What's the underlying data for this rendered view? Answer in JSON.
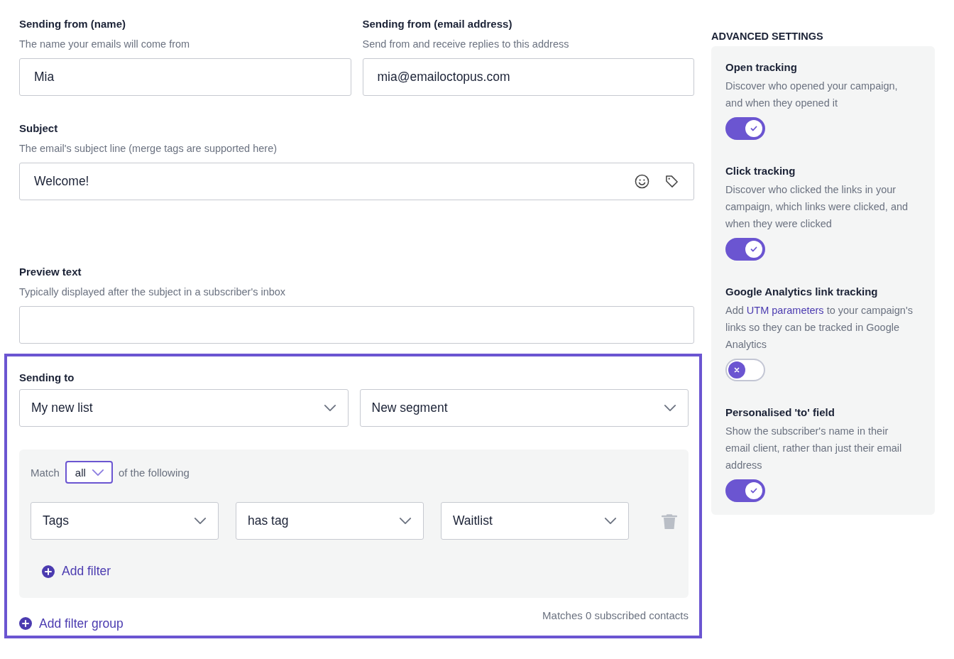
{
  "sender_name": {
    "label": "Sending from (name)",
    "help": "The name your emails will come from",
    "value": "Mia"
  },
  "sender_email": {
    "label": "Sending from (email address)",
    "help": "Send from and receive replies to this address",
    "value": "mia@emailoctopus.com"
  },
  "subject": {
    "label": "Subject",
    "help": "The email's subject line (merge tags are supported here)",
    "value": "Welcome!"
  },
  "preview_text": {
    "label": "Preview text",
    "help": "Typically displayed after the subject in a subscriber's inbox"
  },
  "sending_to": {
    "label": "Sending to",
    "highlighted": true,
    "list": "My new list",
    "segment": "New segment",
    "filter_group": {
      "match_label": "Match",
      "match_value": "all",
      "match_suffix": "of the following",
      "filters": [
        {
          "field": "Tags",
          "operator": "has tag",
          "value": "Waitlist"
        }
      ],
      "add_filter": "Add filter"
    },
    "add_filter_group": "Add filter group",
    "matches": "Matches 0 subscribed contacts"
  },
  "advanced": {
    "heading": "ADVANCED SETTINGS",
    "settings": [
      {
        "title": "Open tracking",
        "description": "Discover who opened your campaign, and when they opened it",
        "on": true
      },
      {
        "title": "Click tracking",
        "description": "Discover who clicked the links in your campaign, which links were clicked, and when they were clicked",
        "on": true
      },
      {
        "title": "Google Analytics link tracking",
        "description": "Add ",
        "link": "UTM parameters",
        "description_after": " to your campaign's links so they can be tracked in Google Analytics",
        "on": false
      },
      {
        "title": "Personalised 'to' field",
        "description": "Show the subscriber's name in their email client, rather than just their email address",
        "on": true
      }
    ]
  }
}
